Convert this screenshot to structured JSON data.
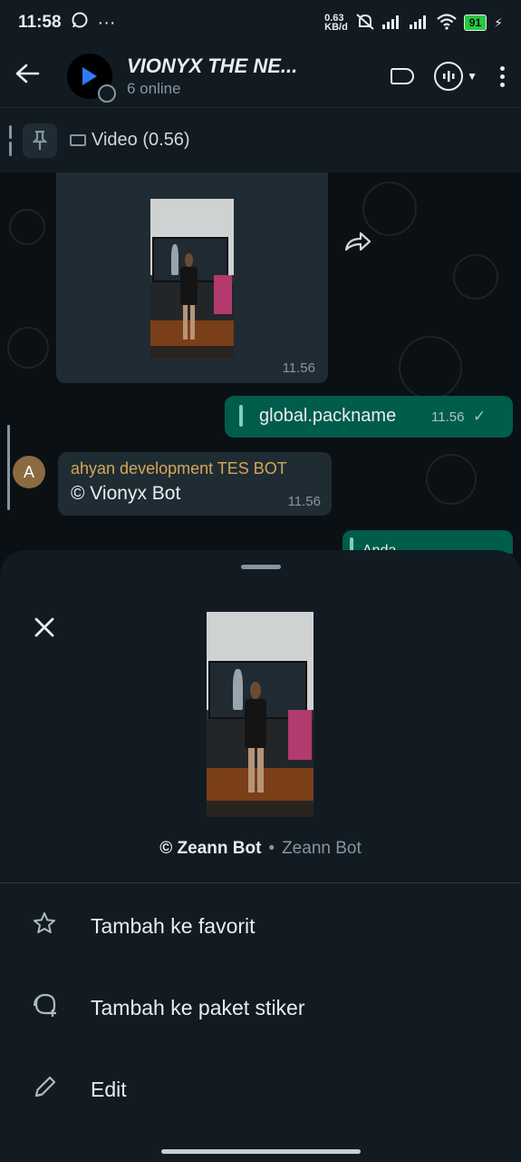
{
  "status_bar": {
    "time": "11:58",
    "whatsapp_icon": "whatsapp-icon",
    "more": "···",
    "net_speed_top": "0.63",
    "net_speed_bottom": "KB/d",
    "battery": "91"
  },
  "app_bar": {
    "title": "VIONYX THE NE...",
    "subtitle": "6 online"
  },
  "pinned": {
    "text": "Video (0.56)"
  },
  "chat": {
    "video_bubble_time": "11.56",
    "outgoing_text": "global.packname",
    "outgoing_time": "11.56",
    "outgoing_check": "✓",
    "incoming_avatar_letter": "A",
    "incoming_sender": "ahyan development TES BOT",
    "incoming_text": "© Vionyx Bot",
    "incoming_time": "11.56",
    "partial_outgoing": "Anda"
  },
  "sheet": {
    "caption_primary": "© Zeann Bot",
    "caption_separator": "•",
    "caption_secondary": "Zeann Bot",
    "menu": [
      {
        "icon": "star-icon",
        "label": "Tambah ke favorit"
      },
      {
        "icon": "sticker-add-icon",
        "label": "Tambah ke paket stiker"
      },
      {
        "icon": "pencil-icon",
        "label": "Edit"
      }
    ]
  },
  "colors": {
    "background": "#0b1014",
    "surface": "#121b22",
    "incoming_bubble": "#202c33",
    "outgoing_bubble": "#005c4b",
    "sender_name": "#d6a657"
  }
}
